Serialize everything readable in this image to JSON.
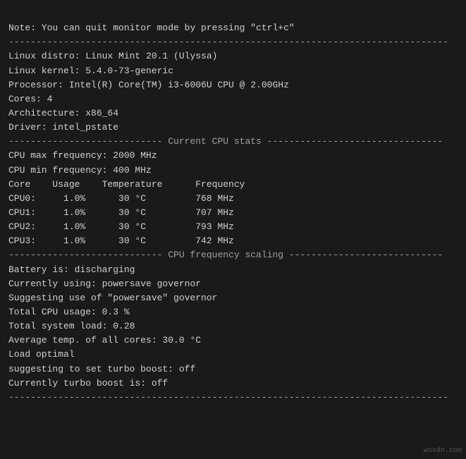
{
  "terminal": {
    "lines": [
      {
        "id": "note",
        "text": "Note: You can quit monitor mode by pressing \"ctrl+c\""
      },
      {
        "id": "sep1",
        "text": "--------------------------------------------------------------------------------"
      },
      {
        "id": "blank1",
        "text": ""
      },
      {
        "id": "distro",
        "text": "Linux distro: Linux Mint 20.1 (Ulyssa)"
      },
      {
        "id": "kernel",
        "text": "Linux kernel: 5.4.0-73-generic"
      },
      {
        "id": "processor",
        "text": "Processor: Intel(R) Core(TM) i3-6006U CPU @ 2.00GHz"
      },
      {
        "id": "cores",
        "text": "Cores: 4"
      },
      {
        "id": "arch",
        "text": "Architecture: x86_64"
      },
      {
        "id": "driver",
        "text": "Driver: intel_pstate"
      },
      {
        "id": "blank2",
        "text": ""
      },
      {
        "id": "sep2",
        "text": "---------------------------- Current CPU stats --------------------------------"
      },
      {
        "id": "blank3",
        "text": ""
      },
      {
        "id": "cpu_max",
        "text": "CPU max frequency: 2000 MHz"
      },
      {
        "id": "cpu_min",
        "text": "CPU min frequency: 400 MHz"
      },
      {
        "id": "blank4",
        "text": ""
      },
      {
        "id": "table_header",
        "text": "Core    Usage    Temperature      Frequency"
      },
      {
        "id": "cpu0",
        "text": "CPU0:     1.0%      30 °C         768 MHz"
      },
      {
        "id": "cpu1",
        "text": "CPU1:     1.0%      30 °C         707 MHz"
      },
      {
        "id": "cpu2",
        "text": "CPU2:     1.0%      30 °C         793 MHz"
      },
      {
        "id": "cpu3",
        "text": "CPU3:     1.0%      30 °C         742 MHz"
      },
      {
        "id": "blank5",
        "text": ""
      },
      {
        "id": "sep3",
        "text": "---------------------------- CPU frequency scaling ----------------------------"
      },
      {
        "id": "blank6",
        "text": ""
      },
      {
        "id": "battery",
        "text": "Battery is: discharging"
      },
      {
        "id": "blank7",
        "text": ""
      },
      {
        "id": "governor1",
        "text": "Currently using: powersave governor"
      },
      {
        "id": "governor2",
        "text": "Suggesting use of \"powersave\" governor"
      },
      {
        "id": "blank8",
        "text": ""
      },
      {
        "id": "total_usage",
        "text": "Total CPU usage: 0.3 %"
      },
      {
        "id": "total_load",
        "text": "Total system load: 0.28"
      },
      {
        "id": "avg_temp",
        "text": "Average temp. of all cores: 30.0 °C"
      },
      {
        "id": "blank9",
        "text": ""
      },
      {
        "id": "load_optimal",
        "text": "Load optimal"
      },
      {
        "id": "turbo_suggest",
        "text": "suggesting to set turbo boost: off"
      },
      {
        "id": "turbo_current",
        "text": "Currently turbo boost is: off"
      },
      {
        "id": "blank10",
        "text": ""
      },
      {
        "id": "sep4",
        "text": "--------------------------------------------------------------------------------"
      }
    ]
  },
  "watermark": {
    "text": "wsxdn.com"
  }
}
